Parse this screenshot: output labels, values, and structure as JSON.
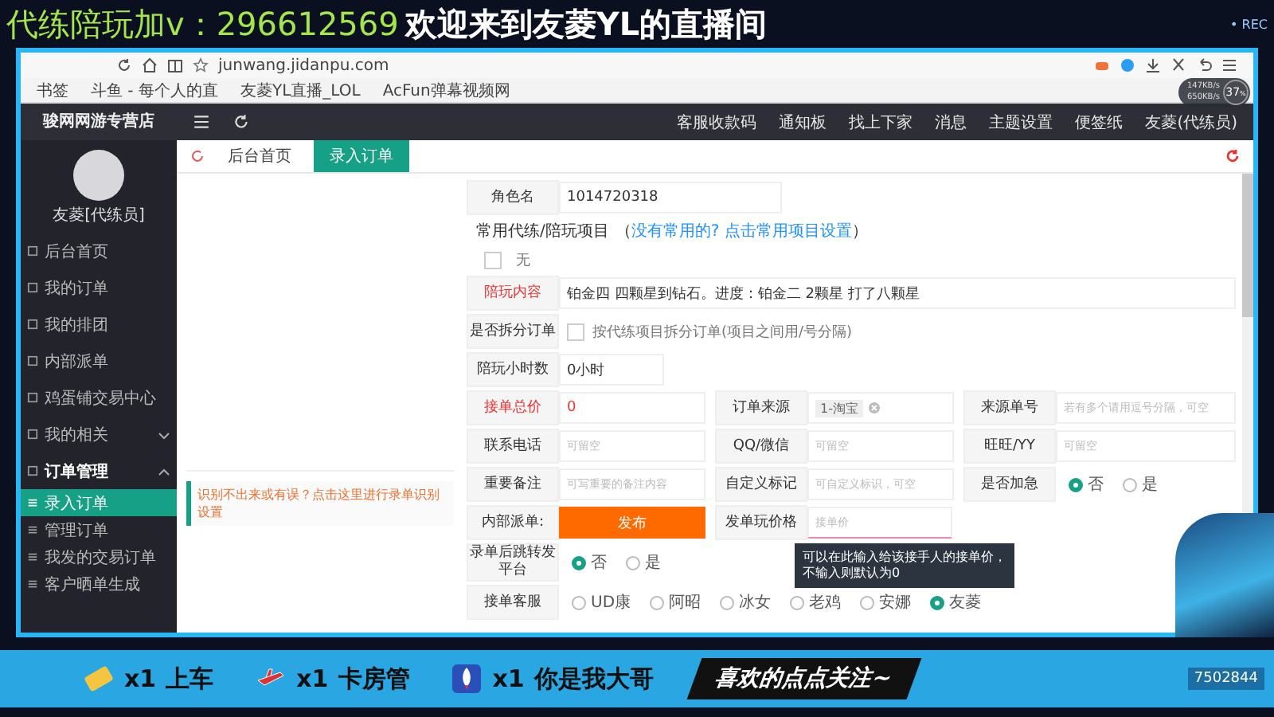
{
  "overlay": {
    "contact": "代练陪玩加v：296612569",
    "title": "欢迎来到友菱YL的直播间",
    "rec": "• REC"
  },
  "browser": {
    "url": "junwang.jidanpu.com",
    "bookmarks": [
      {
        "label": "书签"
      },
      {
        "label": "斗鱼 - 每个人的直"
      },
      {
        "label": "友菱YL直播_LOL"
      },
      {
        "label": "AcFun弹幕视频网"
      }
    ]
  },
  "net_widget": {
    "upload": "147KB/s",
    "download": "650KB/s",
    "percent": "37",
    "unit": "%"
  },
  "app": {
    "shop_name": "骏网网游专营店",
    "nav": [
      "客服收款码",
      "通知板",
      "找上下家",
      "消息",
      "主题设置",
      "便签纸"
    ],
    "account": "友菱(代练员)",
    "tabs": [
      {
        "label": "后台首页",
        "selected": false
      },
      {
        "label": "录入订单",
        "selected": true
      }
    ]
  },
  "sidebar": {
    "user": "友菱[代练员]",
    "items": [
      {
        "label": "后台首页"
      },
      {
        "label": "我的订单"
      },
      {
        "label": "我的排团"
      },
      {
        "label": "内部派单"
      },
      {
        "label": "鸡蛋铺交易中心"
      },
      {
        "label": "我的相关",
        "expanded": false
      },
      {
        "label": "订单管理",
        "expanded": true,
        "children": [
          {
            "label": "录入订单",
            "selected": true
          },
          {
            "label": "管理订单",
            "selected": false
          },
          {
            "label": "我发的交易订单",
            "selected": false
          },
          {
            "label": "客户晒单生成",
            "selected": false
          }
        ]
      }
    ]
  },
  "form": {
    "hint": "识别不出来或有误？点击这里进行录单识别设置",
    "role": {
      "label": "角色名",
      "value": "1014720318"
    },
    "projects": {
      "label": "常用代练/陪玩项目",
      "open": "（",
      "link": "没有常用的? 点击常用项目设置",
      "close": "）",
      "options": [
        {
          "label": "无",
          "checked": false
        }
      ]
    },
    "content": {
      "label": "陪玩内容",
      "required": true,
      "value": "铂金四 四颗星到钻石。进度：铂金二 2颗星 打了八颗星"
    },
    "split": {
      "label": "是否拆分订单",
      "option": "按代练项目拆分订单(项目之间用/号分隔)",
      "checked": false
    },
    "hours": {
      "label": "陪玩小时数",
      "value": "0小时"
    },
    "grid": [
      [
        {
          "kind": "input",
          "label": "接单总价",
          "required": true,
          "value": "0"
        },
        {
          "kind": "tag-select",
          "label": "订单来源",
          "tag": "1-淘宝"
        },
        {
          "kind": "input",
          "label": "来源单号",
          "placeholder": "若有多个请用逗号分隔，可空"
        }
      ],
      [
        {
          "kind": "input",
          "label": "联系电话",
          "placeholder": "可留空"
        },
        {
          "kind": "input",
          "label": "QQ/微信",
          "placeholder": "可留空"
        },
        {
          "kind": "input",
          "label": "旺旺/YY",
          "placeholder": "可留空"
        }
      ],
      [
        {
          "kind": "input",
          "label": "重要备注",
          "placeholder": "可写重要的备注内容"
        },
        {
          "kind": "input",
          "label": "自定义标记",
          "placeholder": "可自定义标识，可空"
        },
        {
          "kind": "radio",
          "label": "是否加急",
          "options": [
            {
              "label": "否",
              "selected": true
            },
            {
              "label": "是",
              "selected": false
            }
          ]
        }
      ],
      [
        {
          "kind": "button",
          "label": "内部派单:",
          "button": "发布"
        },
        {
          "kind": "input",
          "label": "发单玩价格",
          "placeholder": "接单价",
          "focused": true,
          "tooltip": "可以在此输入给该接手人的接单价，不输入则默认为0"
        }
      ]
    ],
    "jump": {
      "label": "录单后跳转发平台",
      "options": [
        {
          "label": "否",
          "selected": true
        },
        {
          "label": "是",
          "selected": false
        }
      ]
    },
    "service": {
      "label": "接单客服",
      "options": [
        {
          "label": "UD康",
          "selected": false
        },
        {
          "label": "阿昭",
          "selected": false
        },
        {
          "label": "冰女",
          "selected": false
        },
        {
          "label": "老鸡",
          "selected": false
        },
        {
          "label": "安娜",
          "selected": false
        },
        {
          "label": "友菱",
          "selected": true
        }
      ]
    }
  },
  "gifts": [
    {
      "kind": "ticket",
      "count": "x1",
      "name": "上车"
    },
    {
      "kind": "plane",
      "count": "x1",
      "name": "卡房管"
    },
    {
      "kind": "rocket",
      "count": "x1",
      "name": "你是我大哥"
    }
  ],
  "follow": "喜欢的点点关注~",
  "room_id": "7502844"
}
